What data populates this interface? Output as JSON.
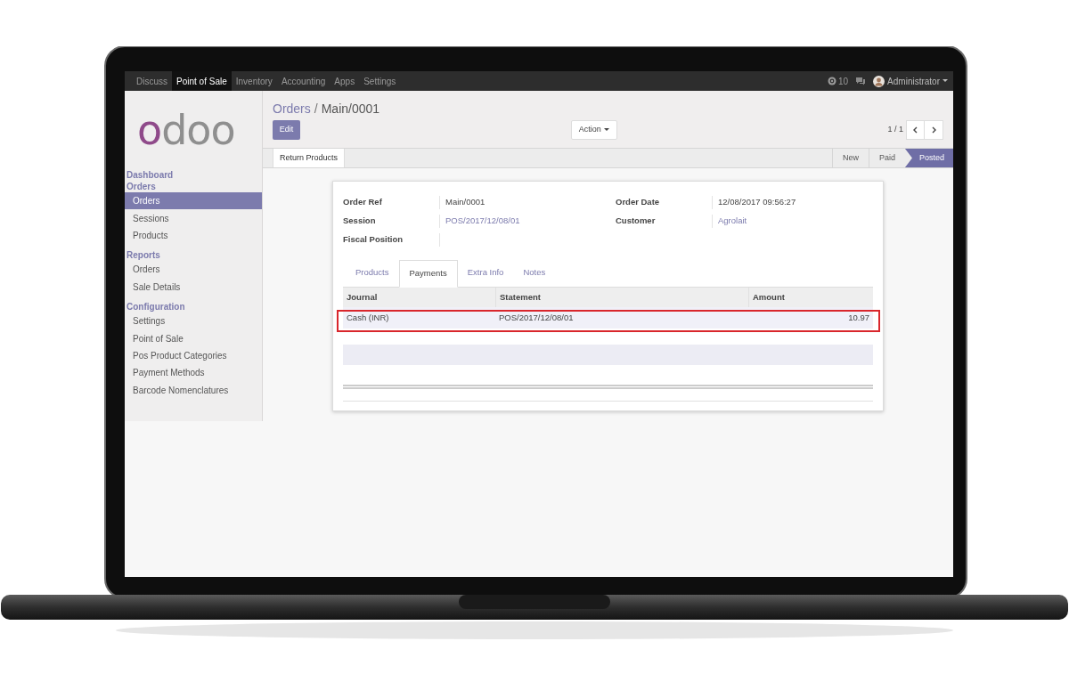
{
  "navbar": {
    "apps": [
      {
        "label": "Discuss",
        "selected": false
      },
      {
        "label": "Point of Sale",
        "selected": true
      },
      {
        "label": "Inventory",
        "selected": false
      },
      {
        "label": "Accounting",
        "selected": false
      },
      {
        "label": "Apps",
        "selected": false
      },
      {
        "label": "Settings",
        "selected": false
      }
    ],
    "notification_count": "10",
    "user": "Administrator"
  },
  "logo": "odoo",
  "sidebar": {
    "sections": [
      {
        "title": "Dashboard"
      },
      {
        "title": "Orders",
        "items": [
          {
            "label": "Orders",
            "selected": true
          },
          {
            "label": "Sessions",
            "selected": false
          },
          {
            "label": "Products",
            "selected": false
          }
        ]
      },
      {
        "title": "Reports",
        "items": [
          {
            "label": "Orders",
            "selected": false
          },
          {
            "label": "Sale Details",
            "selected": false
          }
        ]
      },
      {
        "title": "Configuration",
        "items": [
          {
            "label": "Settings",
            "selected": false
          },
          {
            "label": "Point of Sale",
            "selected": false
          },
          {
            "label": "Pos Product Categories",
            "selected": false
          },
          {
            "label": "Payment Methods",
            "selected": false
          },
          {
            "label": "Barcode Nomenclatures",
            "selected": false
          }
        ]
      }
    ]
  },
  "breadcrumb": {
    "parent": "Orders",
    "separator": "/",
    "current": "Main/0001"
  },
  "buttons": {
    "edit": "Edit",
    "action": "Action"
  },
  "pager": "1 / 1",
  "header_buttons": [
    "Return Products"
  ],
  "statusbar": [
    {
      "label": "New",
      "selected": false
    },
    {
      "label": "Paid",
      "selected": false
    },
    {
      "label": "Posted",
      "selected": true
    }
  ],
  "form": {
    "left": [
      {
        "label": "Order Ref",
        "value": "Main/0001",
        "kind": "text"
      },
      {
        "label": "Session",
        "value": "POS/2017/12/08/01",
        "kind": "link"
      },
      {
        "label": "Fiscal Position"
      }
    ],
    "right": [
      {
        "label": "Order Date",
        "value": "12/08/2017 09:56:27",
        "kind": "text"
      },
      {
        "label": "Customer",
        "value": "Agrolait",
        "kind": "link"
      }
    ]
  },
  "tabs": [
    {
      "label": "Products",
      "selected": false
    },
    {
      "label": "Payments",
      "selected": true
    },
    {
      "label": "Extra Info",
      "selected": false
    },
    {
      "label": "Notes",
      "selected": false
    }
  ],
  "table": {
    "columns": [
      "Journal",
      "Statement",
      "Amount"
    ],
    "rows": [
      {
        "cells": [
          "Cash (INR)",
          "POS/2017/12/08/01",
          "10.97"
        ],
        "highlighted": true
      }
    ]
  }
}
